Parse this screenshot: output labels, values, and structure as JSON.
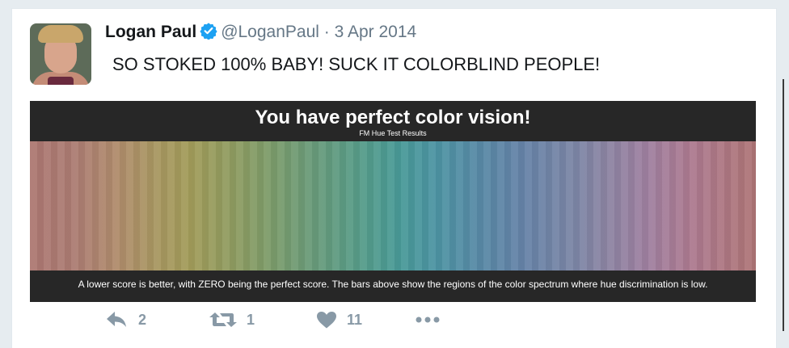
{
  "tweet": {
    "author_name": "Logan Paul",
    "handle": "@LoganPaul",
    "separator": "·",
    "date": "3 Apr 2014",
    "text": "SO STOKED 100% BABY! SUCK IT COLORBLIND PEOPLE!",
    "verified_icon": "verified-badge-icon",
    "accent_color": "#1da1f2"
  },
  "media": {
    "title": "You have perfect color vision!",
    "subtitle": "FM Hue Test Results",
    "caption": "A lower score is better, with ZERO being the perfect score. The bars above show the regions of the color spectrum where hue discrimination is low."
  },
  "actions": {
    "reply": {
      "icon": "reply-icon",
      "count": "2"
    },
    "retweet": {
      "icon": "retweet-icon",
      "count": "1"
    },
    "like": {
      "icon": "heart-icon",
      "count": "11"
    },
    "more": {
      "icon": "more-icon"
    }
  }
}
